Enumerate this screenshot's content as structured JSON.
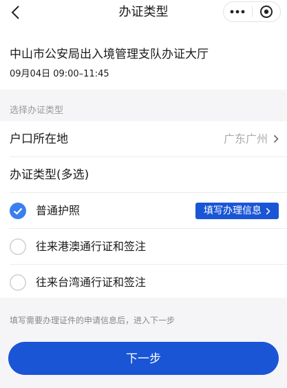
{
  "nav": {
    "title": "办证类型",
    "back_icon": "chevron-left-icon",
    "more_icon": "more-dots-icon",
    "close_icon": "target-circle-icon"
  },
  "office": {
    "name": "中山市公安局出入境管理支队办证大厅",
    "time": "09月04日 09:00–11:45"
  },
  "section": {
    "label": "选择办证类型"
  },
  "household": {
    "label": "户口所在地",
    "value": "广东广州"
  },
  "types": {
    "heading": "办证类型(多选)",
    "options": [
      {
        "label": "普通护照",
        "checked": true,
        "action_label": "填写办理信息"
      },
      {
        "label": "往来港澳通行证和签注",
        "checked": false
      },
      {
        "label": "往来台湾通行证和签注",
        "checked": false
      }
    ]
  },
  "hint": "填写需要办理证件的申请信息后，进入下一步",
  "next_button": "下一步",
  "colors": {
    "accent": "#1a55d6",
    "background": "#f5f5f7"
  }
}
